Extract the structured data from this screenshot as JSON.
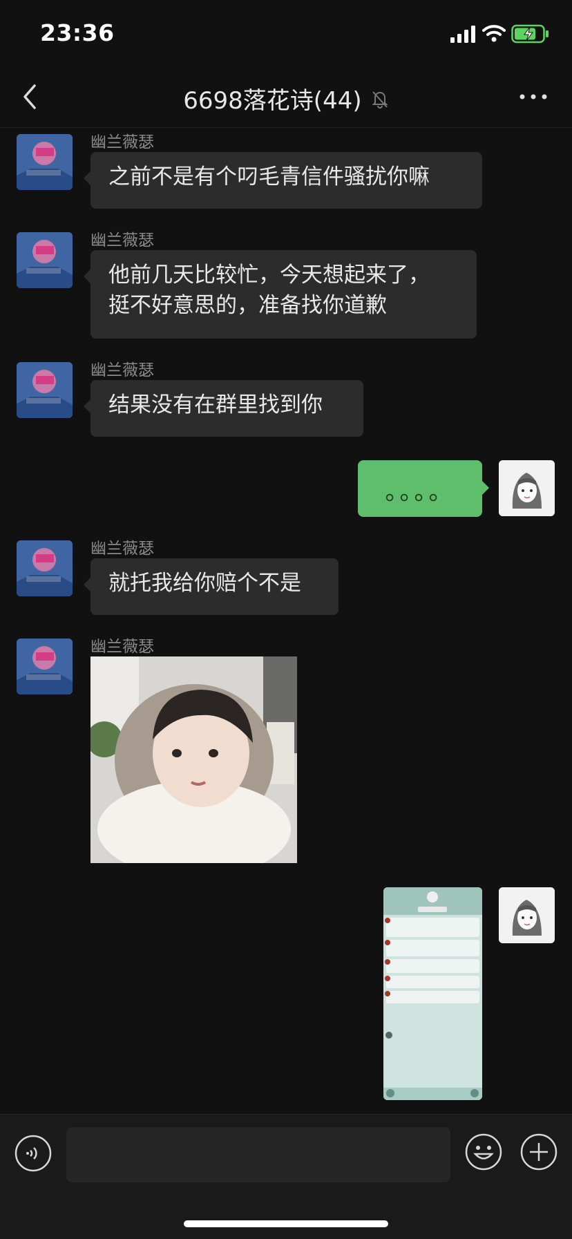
{
  "status": {
    "time": "23:36"
  },
  "nav": {
    "title": "6698落花诗(44)"
  },
  "messages": [
    {
      "sender": "幽兰薇瑟",
      "text": "之前不是有个叼毛青信件骚扰你嘛"
    },
    {
      "sender": "幽兰薇瑟",
      "line1": "他前几天比较忙，今天想起来了，",
      "line2": "挺不好意思的，准备找你道歉"
    },
    {
      "sender": "幽兰薇瑟",
      "text": "结果没有在群里找到你"
    },
    {
      "self_text": "。。。。"
    },
    {
      "sender": "幽兰薇瑟",
      "text": "就托我给你赔个不是"
    },
    {
      "sender": "幽兰薇瑟"
    }
  ],
  "colors": {
    "background": "#111111",
    "bubble_other": "#2c2c2c",
    "bubble_self": "#5fbe6b"
  },
  "icons": {
    "back": "chevron-left-icon",
    "mute": "bell-slash-icon",
    "more": "ellipsis-icon",
    "voice": "voice-icon",
    "emoji": "smiley-icon",
    "plus": "plus-icon"
  }
}
